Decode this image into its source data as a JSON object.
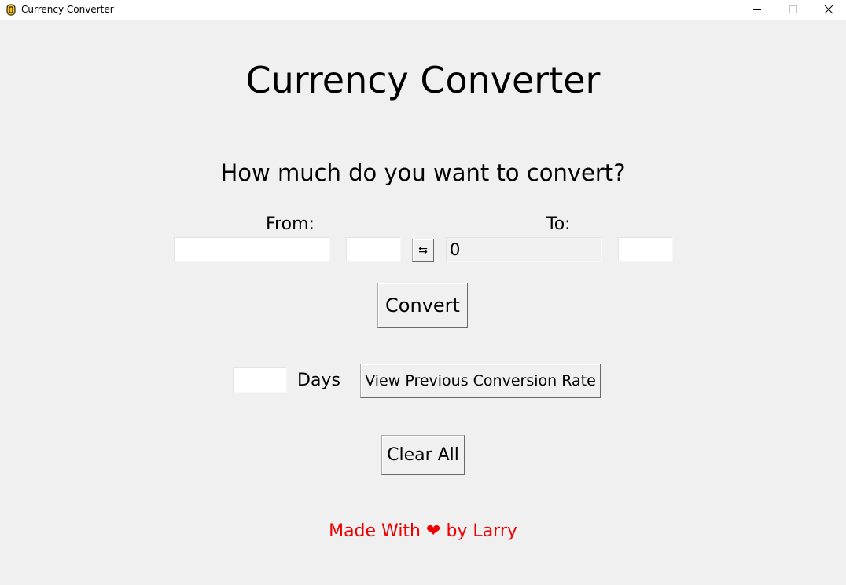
{
  "window": {
    "title": "Currency Converter",
    "icon": "coin-icon"
  },
  "heading": "Currency Converter",
  "question": "How much do you want to convert?",
  "from_section": {
    "label": "From:",
    "amount_value": "",
    "currency_value": ""
  },
  "swap_button": {
    "label": "⇆",
    "icon": "swap-arrows-icon"
  },
  "to_section": {
    "label": "To:",
    "result_value": "0",
    "currency_value": ""
  },
  "convert_button": {
    "label": "Convert"
  },
  "history": {
    "days_value": "",
    "days_label": "Days",
    "view_button_label": "View Previous Conversion Rate"
  },
  "clear_button": {
    "label": "Clear All"
  },
  "footer": {
    "prefix": "Made With",
    "heart": "❤",
    "suffix": "by Larry",
    "color": "#ee0000"
  }
}
